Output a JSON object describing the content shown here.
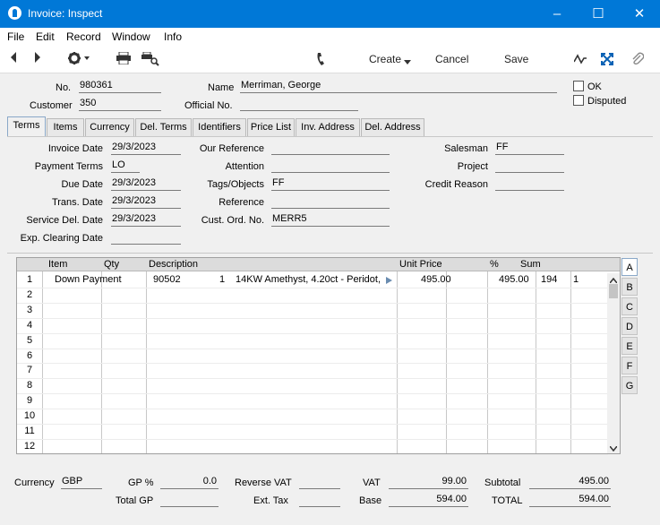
{
  "window": {
    "title": "Invoice: Inspect"
  },
  "menu": [
    "File",
    "Edit",
    "Record",
    "Window",
    "Info"
  ],
  "toolbar": {
    "create": "Create",
    "cancel": "Cancel",
    "save": "Save"
  },
  "header": {
    "no_label": "No.",
    "no_value": "980361",
    "name_label": "Name",
    "name_value": "Merriman, George",
    "customer_label": "Customer",
    "customer_value": "350",
    "official_label": "Official No.",
    "official_value": "",
    "ok_label": "OK",
    "disputed_label": "Disputed"
  },
  "tabs": [
    "Terms",
    "Items",
    "Currency",
    "Del. Terms",
    "Identifiers",
    "Price List",
    "Inv. Address",
    "Del. Address"
  ],
  "terms": {
    "invoice_date_label": "Invoice Date",
    "invoice_date": "29/3/2023",
    "payment_terms_label": "Payment Terms",
    "payment_terms": "LO",
    "due_date_label": "Due Date",
    "due_date": "29/3/2023",
    "trans_date_label": "Trans. Date",
    "trans_date": "29/3/2023",
    "service_date_label": "Service Del. Date",
    "service_date": "29/3/2023",
    "exp_clearing_label": "Exp. Clearing Date",
    "exp_clearing": "",
    "our_ref_label": "Our Reference",
    "our_ref": "",
    "attention_label": "Attention",
    "attention": "",
    "tags_label": "Tags/Objects",
    "tags": "FF",
    "reference_label": "Reference",
    "reference": "",
    "cust_ord_label": "Cust. Ord. No.",
    "cust_ord": "MERR5",
    "salesman_label": "Salesman",
    "salesman": "FF",
    "project_label": "Project",
    "project": "",
    "credit_reason_label": "Credit Reason",
    "credit_reason": ""
  },
  "grid": {
    "columns": [
      "Item",
      "Qty",
      "Description",
      "Unit Price",
      "%",
      "Sum"
    ],
    "row_numbers": [
      "1",
      "2",
      "3",
      "4",
      "5",
      "6",
      "7",
      "8",
      "9",
      "10",
      "11",
      "12"
    ],
    "row1": {
      "item": "Down Payment",
      "code": "90502",
      "qty": "1",
      "description": "14KW Amethyst, 4.20ct - Peridot,",
      "unit_price": "495.00",
      "sum": "495.00",
      "c1": "194",
      "c2": "1"
    }
  },
  "side_tabs": [
    "A",
    "B",
    "C",
    "D",
    "E",
    "F",
    "G"
  ],
  "footer": {
    "currency_label": "Currency",
    "currency": "GBP",
    "gp_pct_label": "GP %",
    "gp_pct": "0.0",
    "total_gp_label": "Total GP",
    "total_gp": "",
    "reverse_vat_label": "Reverse VAT",
    "reverse_vat": "",
    "ext_tax_label": "Ext. Tax",
    "ext_tax": "",
    "vat_label": "VAT",
    "vat": "99.00",
    "base_label": "Base",
    "base": "594.00",
    "subtotal_label": "Subtotal",
    "subtotal": "495.00",
    "total_label": "TOTAL",
    "total": "594.00"
  }
}
